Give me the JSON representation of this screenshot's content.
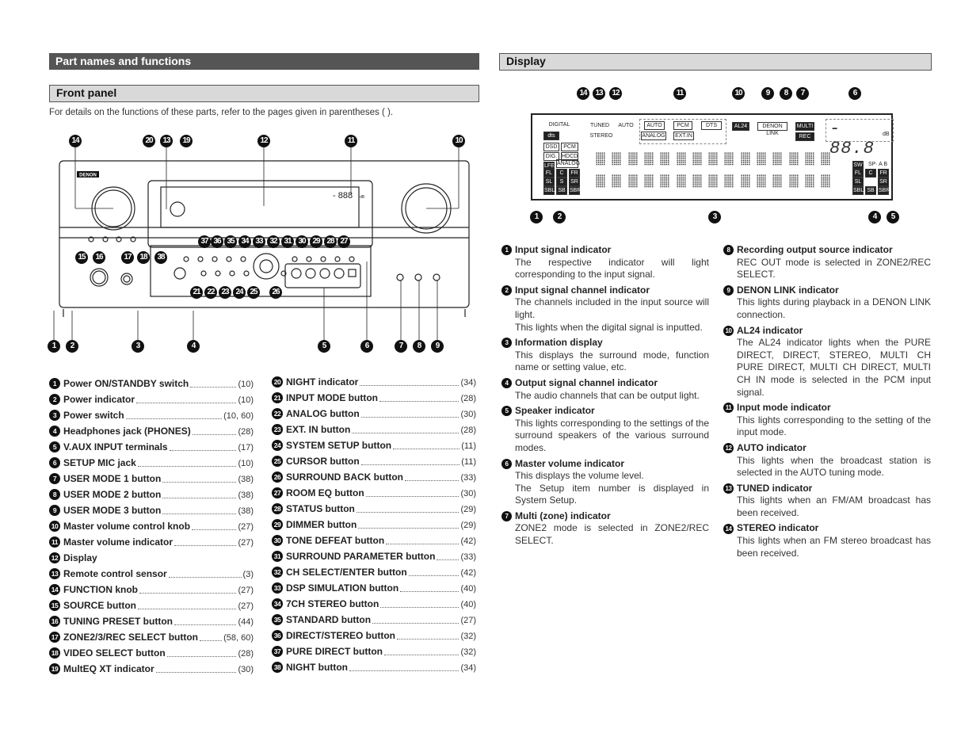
{
  "left": {
    "section_title": "Part names and functions",
    "subsection_title": "Front panel",
    "intro": "For details on the functions of these parts, refer to the pages given in parentheses (  ).",
    "front_panel": {
      "brand_logo": "DENON",
      "display_readout": "- 888",
      "display_unit": "dB",
      "callouts": [
        "14",
        "20",
        "13",
        "19",
        "12",
        "11",
        "10",
        "15",
        "16",
        "17",
        "18",
        "37",
        "36",
        "35",
        "34",
        "33",
        "32",
        "31",
        "30",
        "29",
        "28",
        "27",
        "38",
        "21",
        "22",
        "23",
        "24",
        "25",
        "26",
        "1",
        "2",
        "3",
        "4",
        "5",
        "6",
        "7",
        "8",
        "9"
      ]
    },
    "parts": [
      {
        "n": "1",
        "name": "Power ON/STANDBY switch",
        "page": "(10)"
      },
      {
        "n": "2",
        "name": "Power indicator",
        "page": "(10)"
      },
      {
        "n": "3",
        "name": "Power switch",
        "page": "(10, 60)"
      },
      {
        "n": "4",
        "name": "Headphones jack (PHONES)",
        "page": "(28)"
      },
      {
        "n": "5",
        "name": "V.AUX INPUT terminals",
        "page": "(17)"
      },
      {
        "n": "6",
        "name": "SETUP MIC jack",
        "page": "(10)"
      },
      {
        "n": "7",
        "name": "USER MODE 1 button",
        "page": "(38)"
      },
      {
        "n": "8",
        "name": "USER MODE 2 button",
        "page": "(38)"
      },
      {
        "n": "9",
        "name": "USER MODE 3 button",
        "page": "(38)"
      },
      {
        "n": "10",
        "name": "Master volume control knob",
        "page": "(27)"
      },
      {
        "n": "11",
        "name": "Master volume indicator",
        "page": "(27)"
      },
      {
        "n": "12",
        "name": "Display",
        "page": ""
      },
      {
        "n": "13",
        "name": "Remote control sensor",
        "page": "(3)"
      },
      {
        "n": "14",
        "name": "FUNCTION knob",
        "page": "(27)"
      },
      {
        "n": "15",
        "name": "SOURCE button",
        "page": "(27)"
      },
      {
        "n": "16",
        "name": "TUNING PRESET button",
        "page": "(44)"
      },
      {
        "n": "17",
        "name": "ZONE2/3/REC SELECT button",
        "page": "(58, 60)"
      },
      {
        "n": "18",
        "name": "VIDEO SELECT button",
        "page": "(28)"
      },
      {
        "n": "19",
        "name": "MultEQ XT indicator",
        "page": "(30)"
      },
      {
        "n": "20",
        "name": "NIGHT indicator",
        "page": "(34)"
      },
      {
        "n": "21",
        "name": "INPUT MODE button",
        "page": "(28)"
      },
      {
        "n": "22",
        "name": "ANALOG button",
        "page": "(30)"
      },
      {
        "n": "23",
        "name": "EXT. IN button",
        "page": "(28)"
      },
      {
        "n": "24",
        "name": "SYSTEM SETUP button",
        "page": "(11)"
      },
      {
        "n": "25",
        "name": "CURSOR button",
        "page": "(11)"
      },
      {
        "n": "26",
        "name": "SURROUND BACK button",
        "page": "(33)"
      },
      {
        "n": "27",
        "name": "ROOM EQ button",
        "page": "(30)"
      },
      {
        "n": "28",
        "name": "STATUS button",
        "page": "(29)"
      },
      {
        "n": "29",
        "name": "DIMMER button",
        "page": "(29)"
      },
      {
        "n": "30",
        "name": "TONE DEFEAT button",
        "page": "(42)"
      },
      {
        "n": "31",
        "name": "SURROUND PARAMETER button",
        "page": "(33)"
      },
      {
        "n": "32",
        "name": "CH SELECT/ENTER button",
        "page": "(42)"
      },
      {
        "n": "33",
        "name": "DSP SIMULATION button",
        "page": "(40)"
      },
      {
        "n": "34",
        "name": "7CH STEREO button",
        "page": "(40)"
      },
      {
        "n": "35",
        "name": "STANDARD button",
        "page": "(27)"
      },
      {
        "n": "36",
        "name": "DIRECT/STEREO button",
        "page": "(32)"
      },
      {
        "n": "37",
        "name": "PURE DIRECT button",
        "page": "(32)"
      },
      {
        "n": "38",
        "name": "NIGHT button",
        "page": "(34)"
      }
    ]
  },
  "right": {
    "section_title": "Display",
    "display": {
      "callouts": [
        "14",
        "13",
        "12",
        "11",
        "10",
        "9",
        "8",
        "7",
        "6",
        "1",
        "2",
        "3",
        "4",
        "5"
      ],
      "digital": "DIGITAL",
      "dts": "dts",
      "input_signal": [
        "DSD",
        "PCM",
        "DIG.",
        "HDCD",
        "LFE",
        "ANALOG"
      ],
      "input_channels": [
        "FL",
        "C",
        "FR",
        "SL",
        "S",
        "SR",
        "SBL",
        "SB",
        "SBR"
      ],
      "tuned": "TUNED",
      "auto": "AUTO",
      "stereo": "STEREO",
      "input_mode": [
        "AUTO",
        "PCM",
        "DTS",
        "ANALOG",
        "EXT.IN"
      ],
      "al24": "AL24",
      "denon_link": "DENON LINK",
      "multi": "MULTI",
      "rec": "REC",
      "volume": "- 88.8",
      "volume_unit": "dB",
      "output_channels": [
        "SW",
        "FL",
        "C",
        "FR",
        "SL",
        "SR",
        "SBL",
        "SB",
        "SBR"
      ],
      "speaker": "SP· A B"
    },
    "items": [
      {
        "n": "1",
        "title": "Input signal indicator",
        "body": [
          "The respective indicator will light corresponding to the input signal."
        ]
      },
      {
        "n": "2",
        "title": "Input signal channel indicator",
        "body": [
          "The channels included in the input source will light.",
          "This lights when the digital signal is inputted."
        ]
      },
      {
        "n": "3",
        "title": "Information display",
        "body": [
          "This displays the surround mode, function name or setting value, etc."
        ]
      },
      {
        "n": "4",
        "title": "Output signal channel indicator",
        "body": [
          "The audio channels that can be output light."
        ]
      },
      {
        "n": "5",
        "title": "Speaker indicator",
        "body": [
          "This lights corresponding to the settings of the surround speakers of the various surround modes."
        ]
      },
      {
        "n": "6",
        "title": "Master volume indicator",
        "body": [
          "This displays the volume level.",
          "The Setup item number is displayed in System Setup."
        ]
      },
      {
        "n": "7",
        "title": "Multi (zone) indicator",
        "body": [
          "ZONE2 mode is selected in ZONE2/REC SELECT."
        ]
      },
      {
        "n": "8",
        "title": "Recording output source indicator",
        "body": [
          "REC OUT mode is selected in ZONE2/REC SELECT."
        ]
      },
      {
        "n": "9",
        "title": "DENON LINK indicator",
        "body": [
          "This lights during playback in a DENON LINK connection."
        ]
      },
      {
        "n": "10",
        "title": "AL24 indicator",
        "body": [
          "The AL24 indicator lights when the PURE DIRECT, DIRECT, STEREO, MULTI CH PURE DIRECT, MULTI CH DIRECT, MULTI CH IN mode is selected in the PCM input signal."
        ]
      },
      {
        "n": "11",
        "title": "Input mode indicator",
        "body": [
          "This lights corresponding to the setting of the input mode."
        ]
      },
      {
        "n": "12",
        "title": "AUTO indicator",
        "body": [
          "This lights when the broadcast station is selected in the AUTO tuning mode."
        ]
      },
      {
        "n": "13",
        "title": "TUNED indicator",
        "body": [
          "This lights when an FM/AM broadcast has been received."
        ]
      },
      {
        "n": "14",
        "title": "STEREO indicator",
        "body": [
          "This lights when an FM stereo broadcast has been received."
        ]
      }
    ]
  }
}
